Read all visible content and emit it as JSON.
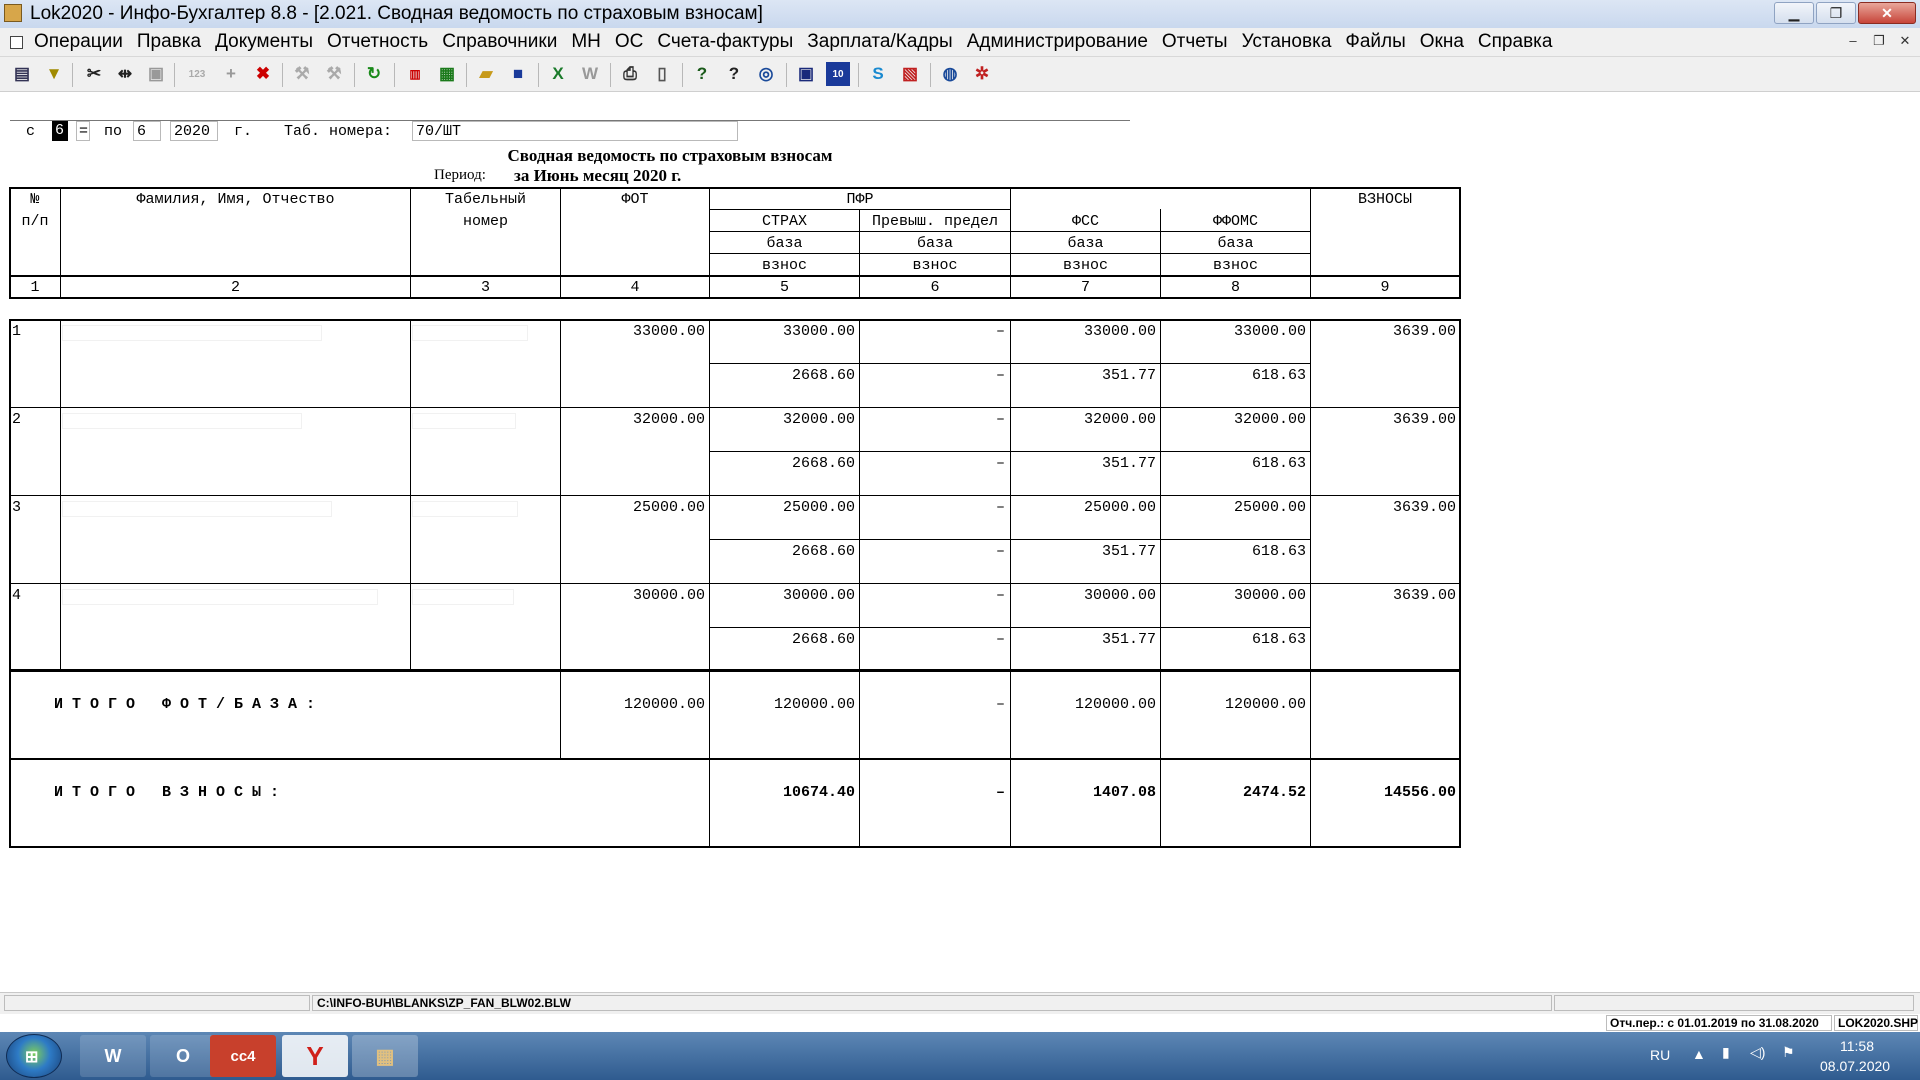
{
  "window": {
    "title": "Lok2020 - Инфо-Бухгалтер 8.8 - [2.021. Сводная ведомость по страховым взносам]"
  },
  "menu": [
    "Операции",
    "Правка",
    "Документы",
    "Отчетность",
    "Справочники",
    "МН",
    "ОС",
    "Счета-фактуры",
    "Зарплата/Кадры",
    "Администрирование",
    "Отчеты",
    "Установка",
    "Файлы",
    "Окна",
    "Справка"
  ],
  "toolbar_icons": [
    "sheet-icon",
    "filter-icon",
    "cut-icon",
    "split-icon",
    "paste-icon",
    "numbering-icon",
    "add-icon",
    "delete-icon",
    "tool-icon",
    "tool2-icon",
    "refresh-icon",
    "pdf-icon",
    "calculator-icon",
    "open-folder-icon",
    "save-icon",
    "excel-icon",
    "word-icon",
    "print-icon",
    "preview-icon",
    "help-icon",
    "context-help-icon",
    "compass-icon",
    "book-icon",
    "ib10-icon",
    "skype-icon",
    "remote-icon",
    "globe-icon",
    "network-icon"
  ],
  "params": {
    "from_label": "с",
    "from_value": "6",
    "eq": "=",
    "to_label": "по",
    "to_value": "6",
    "year_value": "2020",
    "year_suffix": "г.",
    "tab_label": "Таб. номера:",
    "tab_value": "70/ШТ"
  },
  "report": {
    "title": "Сводная ведомость по страховым взносам",
    "period_label": "Период:",
    "period_value": "за Июнь месяц 2020 г."
  },
  "headers": {
    "num_1": "№",
    "num_2": "п/п",
    "fio": "Фамилия, Имя, Отчество",
    "tabnum_1": "Табельный",
    "tabnum_2": "номер",
    "fot": "ФОТ",
    "pfr": "ПФР",
    "strakh": "СТРАХ",
    "prevysh": "Превыш. предел",
    "fss": "ФСС",
    "ffoms": "ФФОМС",
    "baza": "база",
    "vznos": "взнос",
    "vznosy": "ВЗНОСЫ",
    "colnums": [
      "1",
      "2",
      "3",
      "4",
      "5",
      "6",
      "7",
      "8",
      "9"
    ]
  },
  "rows": [
    {
      "n": "1",
      "fot": "33000.00",
      "strakh_base": "33000.00",
      "prev_base": "–",
      "fss_base": "33000.00",
      "ffoms_base": "33000.00",
      "total": "3639.00",
      "strakh_vznos": "2668.60",
      "prev_vznos": "–",
      "fss_vznos": "351.77",
      "ffoms_vznos": "618.63"
    },
    {
      "n": "2",
      "fot": "32000.00",
      "strakh_base": "32000.00",
      "prev_base": "–",
      "fss_base": "32000.00",
      "ffoms_base": "32000.00",
      "total": "3639.00",
      "strakh_vznos": "2668.60",
      "prev_vznos": "–",
      "fss_vznos": "351.77",
      "ffoms_vznos": "618.63"
    },
    {
      "n": "3",
      "fot": "25000.00",
      "strakh_base": "25000.00",
      "prev_base": "–",
      "fss_base": "25000.00",
      "ffoms_base": "25000.00",
      "total": "3639.00",
      "strakh_vznos": "2668.60",
      "prev_vznos": "–",
      "fss_vznos": "351.77",
      "ffoms_vznos": "618.63"
    },
    {
      "n": "4",
      "fot": "30000.00",
      "strakh_base": "30000.00",
      "prev_base": "–",
      "fss_base": "30000.00",
      "ffoms_base": "30000.00",
      "total": "3639.00",
      "strakh_vznos": "2668.60",
      "prev_vznos": "–",
      "fss_vznos": "351.77",
      "ffoms_vznos": "618.63"
    }
  ],
  "totals": {
    "fot_label": "И Т О Г О   Ф О Т / Б А З А :",
    "fot": "120000.00",
    "strakh": "120000.00",
    "prevysh": "–",
    "fss": "120000.00",
    "ffoms": "120000.00",
    "vznosy_label": "И Т О Г О   В З Н О С Ы :",
    "v_strakh": "10674.40",
    "v_prevysh": "–",
    "v_fss": "1407.08",
    "v_ffoms": "2474.52",
    "v_total": "14556.00"
  },
  "status": {
    "path": "C:\\INFO-BUH\\BLANKS\\ZP_FAN_BLW02.BLW",
    "period": "Отч.пер.: с 01.01.2019 по 31.08.2020",
    "file": "LOK2020.SHP"
  },
  "taskbar": {
    "apps": [
      "word-icon",
      "outlook-icon",
      "cc4-icon",
      "yandex-icon",
      "abacus-icon"
    ],
    "lang": "RU",
    "time": "11:58",
    "date": "08.07.2020"
  }
}
